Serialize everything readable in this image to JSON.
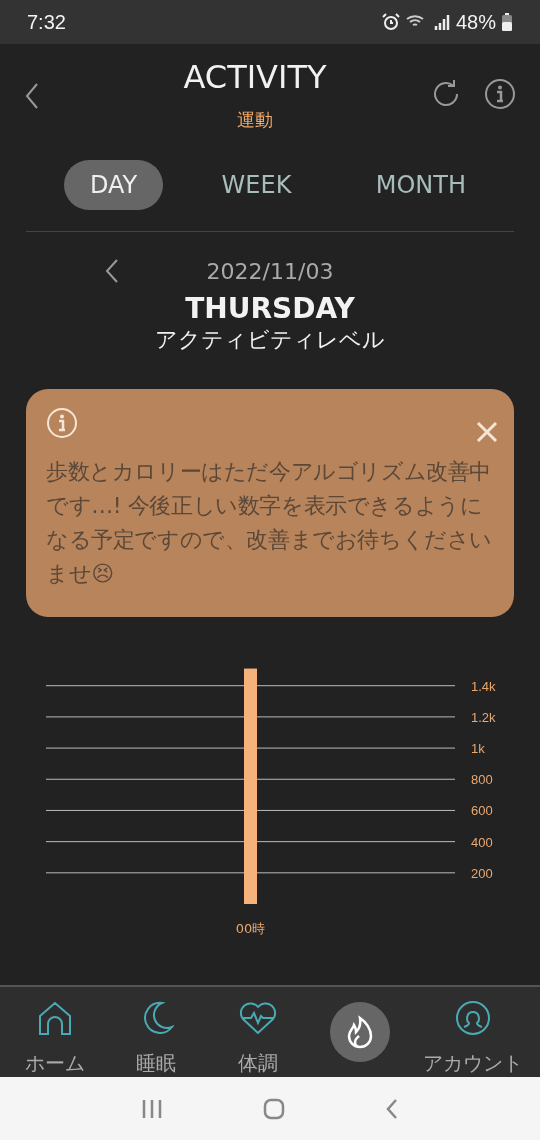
{
  "status_bar": {
    "time": "7:32",
    "battery": "48%"
  },
  "header": {
    "title": "ACTIVITY",
    "subtitle": "運動"
  },
  "tabs": [
    {
      "label": "DAY",
      "selected": true
    },
    {
      "label": "WEEK",
      "selected": false
    },
    {
      "label": "MONTH",
      "selected": false
    }
  ],
  "date_nav": {
    "date": "2022/11/03",
    "weekday": "THURSDAY",
    "subtitle": "アクティビティレベル"
  },
  "notice": {
    "message": "歩数とカロリーはただ今アルゴリズム改善中です…! 今後正しい数字を表示できるようになる予定ですので、改善までお待ちくださいませ😣"
  },
  "chart": {
    "chart_data": {
      "type": "bar",
      "categories": [
        "00時"
      ],
      "series": [
        {
          "color": "#f5b27a",
          "values": [
            1510
          ]
        }
      ],
      "ylim": [
        0,
        1520
      ],
      "grid": true,
      "yticks": [
        {
          "value": 200,
          "label": "200"
        },
        {
          "value": 400,
          "label": "400"
        },
        {
          "value": 600,
          "label": "600"
        },
        {
          "value": 800,
          "label": "800"
        },
        {
          "value": 1000,
          "label": "1k"
        },
        {
          "value": 1200,
          "label": "1.2k"
        },
        {
          "value": 1400,
          "label": "1.4k"
        }
      ]
    }
  },
  "bottom_nav": [
    {
      "kind": "home",
      "label": "ホーム",
      "selected": false
    },
    {
      "kind": "sleep",
      "label": "睡眠",
      "selected": false
    },
    {
      "kind": "health",
      "label": "体調",
      "selected": false
    },
    {
      "kind": "activity",
      "selected": true
    },
    {
      "kind": "account",
      "label": "アカウント",
      "selected": false
    }
  ]
}
